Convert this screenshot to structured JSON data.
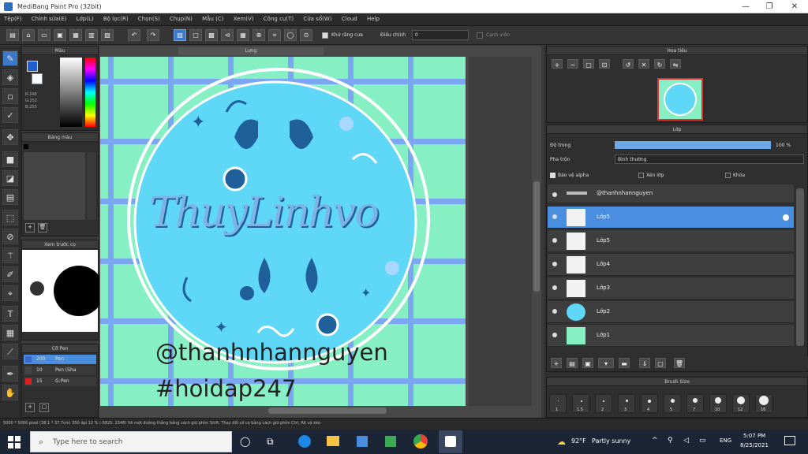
{
  "window": {
    "title": "MediBang Paint Pro (32bit)",
    "minimize": "—",
    "maximize": "❐",
    "close": "✕"
  },
  "menu": [
    "Tệp(F)",
    "Chỉnh sửa(E)",
    "Lớp(L)",
    "Bộ lọc(R)",
    "Chọn(S)",
    "Chụp(N)",
    "Mẫu (C)",
    "Xem(V)",
    "Công cụ(T)",
    "Cửa sổ(W)",
    "Cloud",
    "Help"
  ],
  "toolbar": {
    "autofill_label": "Khử răng cưa",
    "correction_label": "Điều chỉnh",
    "correction_value": "0",
    "snap_label": "Cạnh viền"
  },
  "color_panel": {
    "title": "Màu",
    "values_line1": "R:248",
    "values_line2": "G:252",
    "values_line3": "B:255"
  },
  "palette_panel": {
    "title": "Bảng màu"
  },
  "preview_panel": {
    "title": "Xem trước cọ"
  },
  "brush_panel": {
    "title": "Cỡ Pen",
    "items": [
      {
        "size": "200",
        "name": "Pen",
        "color": "#3a6ad0"
      },
      {
        "size": "10",
        "name": "Pen (Sha",
        "color": "#444444"
      },
      {
        "size": "15",
        "name": "G-Pen",
        "color": "#d82020"
      }
    ]
  },
  "canvas": {
    "tab": "Lưng",
    "text_handle": "@thanhnhannguyen",
    "text_tag": "#hoidap247",
    "logo_text": "ThuyLinhvo"
  },
  "navigator": {
    "title": "Hoa tiêu"
  },
  "layers_panel": {
    "title": "Lớp",
    "opacity_label": "Độ trong",
    "opacity_value": "100 %",
    "blend_label": "Pha trộn",
    "blend_value": "Bình thường",
    "protect_alpha": "Bảo vệ alpha",
    "clipping": "Xén lớp",
    "lock": "Khóa",
    "layers": [
      {
        "name": "@thanhnhannguyen",
        "selected": false
      },
      {
        "name": "Lớp5",
        "selected": true
      },
      {
        "name": "Lớp5",
        "selected": false
      },
      {
        "name": "Lớp4",
        "selected": false
      },
      {
        "name": "Lớp3",
        "selected": false
      },
      {
        "name": "Lớp2",
        "selected": false
      },
      {
        "name": "Lớp1",
        "selected": false
      }
    ]
  },
  "brush_size_panel": {
    "title": "Brush Size",
    "sizes": [
      "1",
      "1.5",
      "2",
      "3",
      "4",
      "5",
      "7",
      "10",
      "12",
      "16"
    ]
  },
  "statusbar": {
    "text": "5000 * 5000 pixel (38.1 * 37.7cm) 350 dpi 12 % (-5825, 2348) Vẽ một đường thẳng bằng cách giữ phím Shift, Thay đổi cỡ cọ bằng cách giữ phím Ctrl, Alt và kéo"
  },
  "taskbar": {
    "search_placeholder": "Type here to search",
    "weather_temp": "92°F",
    "weather_text": "Partly sunny",
    "lang": "ENG",
    "time": "5:07 PM",
    "date": "8/25/2021"
  },
  "colors": {
    "accent": "#4a8ee0",
    "canvas_bg": "#86f0c4",
    "grid": "#7aa6f2",
    "circle": "#5fd8f7",
    "dark_blue": "#1f5f9a"
  }
}
